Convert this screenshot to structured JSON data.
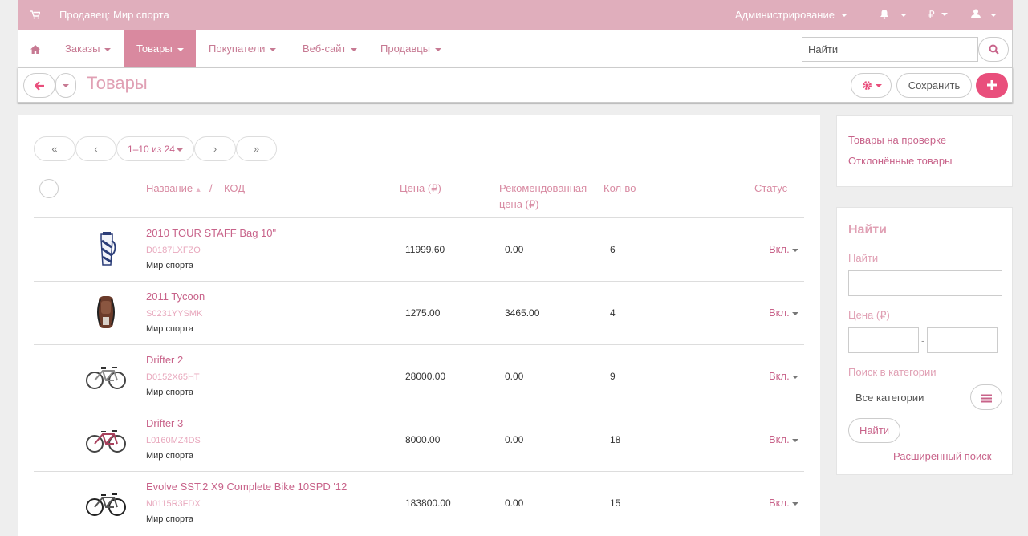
{
  "topbar": {
    "vendor": "Продавец: Мир спорта",
    "admin": "Администрирование",
    "currency": "₽"
  },
  "nav": {
    "items": [
      "Заказы",
      "Товары",
      "Покупатели",
      "Веб-сайт",
      "Продавцы"
    ],
    "search_placeholder": "Найти"
  },
  "header": {
    "title": "Товары",
    "save_label": "Сохранить"
  },
  "pager": {
    "range": "1–10 из 24",
    "first": "«",
    "prev": "‹",
    "next": "›",
    "last": "»"
  },
  "table": {
    "headers": {
      "name": "Название",
      "slash": "/",
      "code": "КОД",
      "price": "Цена (₽)",
      "rec_price_1": "Рекомендованная",
      "rec_price_2": "цена (₽)",
      "qty": "Кол-во",
      "status": "Статус"
    },
    "rows": [
      {
        "name": "2010 TOUR STAFF Bag 10\"",
        "code": "D0187LXFZO",
        "vendor": "Мир спорта",
        "price": "11999.60",
        "rec_price": "0.00",
        "qty": "6",
        "status": "Вкл.",
        "thumb": "golf-bag"
      },
      {
        "name": "2011 Tycoon",
        "code": "S0231YYSMK",
        "vendor": "Мир спорта",
        "price": "1275.00",
        "rec_price": "3465.00",
        "qty": "4",
        "status": "Вкл.",
        "thumb": "backpack"
      },
      {
        "name": "Drifter 2",
        "code": "D0152X65HT",
        "vendor": "Мир спорта",
        "price": "28000.00",
        "rec_price": "0.00",
        "qty": "9",
        "status": "Вкл.",
        "thumb": "bicycle"
      },
      {
        "name": "Drifter 3",
        "code": "L0160MZ4DS",
        "vendor": "Мир спорта",
        "price": "8000.00",
        "rec_price": "0.00",
        "qty": "18",
        "status": "Вкл.",
        "thumb": "bicycle"
      },
      {
        "name": "Evolve SST.2 X9 Complete Bike 10SPD '12",
        "code": "N0115R3FDX",
        "vendor": "Мир спорта",
        "price": "183800.00",
        "rec_price": "0.00",
        "qty": "15",
        "status": "Вкл.",
        "thumb": "bicycle"
      }
    ]
  },
  "sidebar": {
    "links": [
      "Товары на проверке",
      "Отклонённые товары"
    ],
    "search": {
      "heading": "Найти",
      "find_label": "Найти",
      "price_label": "Цена (₽)",
      "price_sep": "-",
      "category_label": "Поиск в категории",
      "category_value": "Все категории",
      "find_button": "Найти",
      "advanced": "Расширенный поиск"
    }
  },
  "colors": {
    "accent": "#e94f7c",
    "topbar": "#e0aebc",
    "link": "#c8638a"
  }
}
